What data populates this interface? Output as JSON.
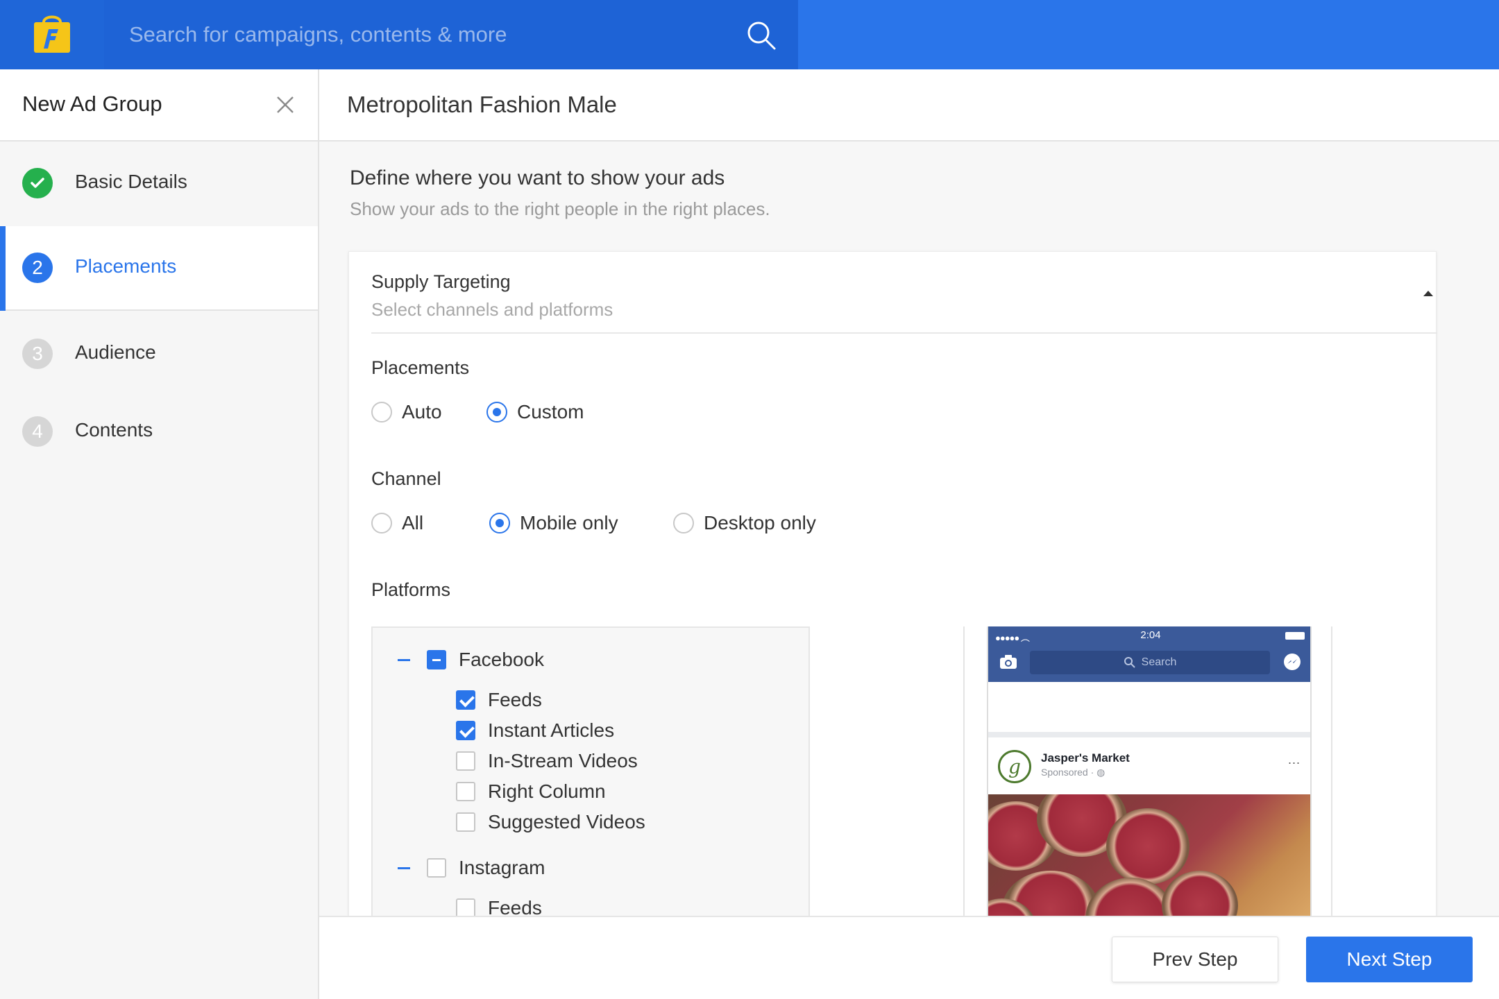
{
  "colors": {
    "brand_blue": "#2a75ea",
    "success_green": "#25b04d",
    "logo_yellow": "#f5c518"
  },
  "header": {
    "logo_icon": "flipkart-bag-icon",
    "search_placeholder": "Search for campaigns, contents & more"
  },
  "sidebar": {
    "title": "New Ad Group",
    "steps": [
      {
        "number": "",
        "label": "Basic Details",
        "state": "done"
      },
      {
        "number": "2",
        "label": "Placements",
        "state": "active"
      },
      {
        "number": "3",
        "label": "Audience",
        "state": "todo"
      },
      {
        "number": "4",
        "label": "Contents",
        "state": "todo"
      }
    ]
  },
  "main": {
    "title": "Metropolitan Fashion Male",
    "section_title": "Define where you want to show your ads",
    "section_subtitle": "Show your ads to the right people in the right places."
  },
  "supply": {
    "title": "Supply Targeting",
    "subtitle": "Select channels and platforms",
    "placements": {
      "label": "Placements",
      "options": [
        "Auto",
        "Custom"
      ],
      "selected": "Custom"
    },
    "channel": {
      "label": "Channel",
      "options": [
        "All",
        "Mobile only",
        "Desktop only"
      ],
      "selected": "Mobile only"
    },
    "platforms": {
      "label": "Platforms",
      "groups": [
        {
          "name": "Facebook",
          "state": "partial",
          "items": [
            {
              "label": "Feeds",
              "checked": true
            },
            {
              "label": "Instant Articles",
              "checked": true
            },
            {
              "label": "In-Stream Videos",
              "checked": false
            },
            {
              "label": "Right Column",
              "checked": false
            },
            {
              "label": "Suggested Videos",
              "checked": false
            }
          ]
        },
        {
          "name": "Instagram",
          "state": "unchecked",
          "items": [
            {
              "label": "Feeds",
              "checked": false
            }
          ]
        }
      ]
    }
  },
  "preview": {
    "time": "2:04",
    "search": "Search",
    "advertiser": "Jasper's Market",
    "sponsored": "Sponsored ·",
    "more": "..."
  },
  "footer": {
    "prev_label": "Prev Step",
    "next_label": "Next Step"
  }
}
